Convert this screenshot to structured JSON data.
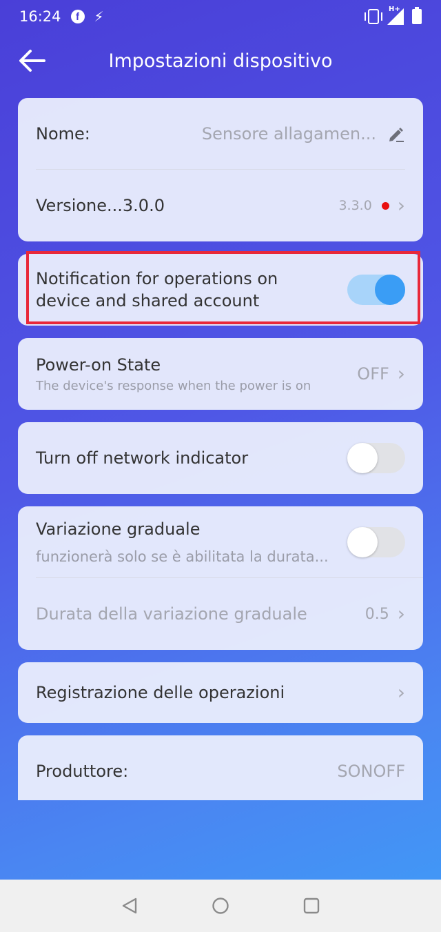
{
  "status_bar": {
    "time": "16:24"
  },
  "header": {
    "title": "Impostazioni dispositivo"
  },
  "card_info": {
    "name_label": "Nome:",
    "name_value": "Sensore allagamen...",
    "version_label": "Versione...3.0.0",
    "version_value": "3.3.0"
  },
  "notification": {
    "label_line1": "Notification for operations on",
    "label_line2": "device and shared account",
    "enabled": true
  },
  "power_on": {
    "label": "Power-on State",
    "description": "The device's response when the power is on",
    "value": "OFF"
  },
  "network_indicator": {
    "label": "Turn off network indicator",
    "enabled": false
  },
  "gradual": {
    "label": "Variazione graduale",
    "description": "funzionerà solo se è abilitata la durata...",
    "enabled": false,
    "duration_label": "Durata della variazione graduale",
    "duration_value": "0.5"
  },
  "operations_log": {
    "label": "Registrazione delle operazioni"
  },
  "manufacturer": {
    "label": "Produttore:",
    "value": "SONOFF"
  },
  "colors": {
    "accent": "#3a9df5",
    "highlight": "#e8283a",
    "update_dot": "#e81010"
  }
}
